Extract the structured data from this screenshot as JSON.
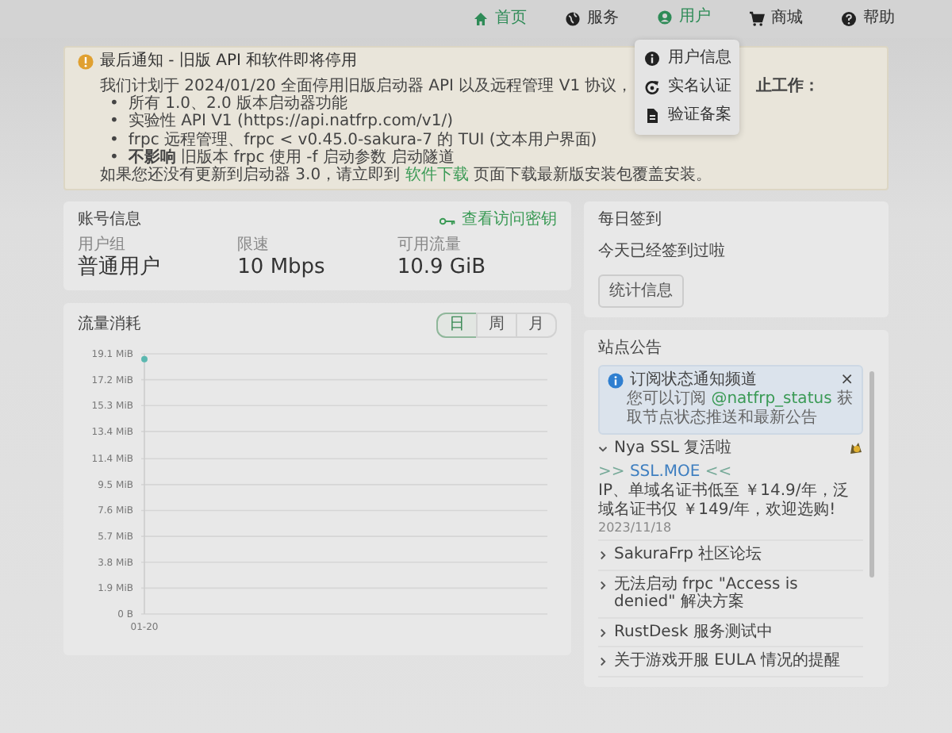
{
  "nav": {
    "items": [
      {
        "label": "首页",
        "highlighted": true
      },
      {
        "label": "服务",
        "highlighted": false
      },
      {
        "label": "用户",
        "highlighted": true,
        "dropdown": [
          {
            "label": "用户信息"
          },
          {
            "label": "实名认证"
          },
          {
            "label": "验证备案"
          }
        ]
      },
      {
        "label": "商城",
        "highlighted": false
      },
      {
        "label": "帮助",
        "highlighted": false
      }
    ]
  },
  "notice": {
    "title": "最后通知 - 旧版 API 和软件即将停用",
    "intro": "我们计划于 2024/01/20 全面停用旧版启动器 API 以及远程管理 V1 协议，",
    "intro_tail": "止工作：",
    "bullets": [
      {
        "marker": "•",
        "text": "所有 1.0、2.0 版本启动器功能"
      },
      {
        "marker": "•",
        "text": "实验性 API V1 (https://api.natfrp.com/v1/)"
      },
      {
        "marker": "•",
        "text": "frpc 远程管理、frpc < v0.45.0-sakura-7 的 TUI (文本用户界面)"
      },
      {
        "marker": "•",
        "text": "**不影响** 旧版本 frpc 使用 -f 启动参数 启动隧道"
      }
    ],
    "footer_before": "如果您还没有更新到启动器 3.0，请立即到",
    "footer_link": "软件下载",
    "footer_after": "页面下载最新版安装包覆盖安装。"
  },
  "account": {
    "title": "账号信息",
    "link": "查看访问密钥",
    "fields": [
      {
        "label": "用户组",
        "value": "普通用户"
      },
      {
        "label": "限速",
        "value": "10 Mbps"
      },
      {
        "label": "可用流量",
        "value": "10.9 GiB"
      }
    ]
  },
  "traffic": {
    "title": "流量消耗",
    "periods": [
      {
        "label": "日",
        "selected": true
      },
      {
        "label": "周",
        "selected": false
      },
      {
        "label": "月",
        "selected": false
      }
    ],
    "chart_data": {
      "type": "line",
      "grid": true,
      "categories": [
        "01-20"
      ],
      "series": [
        {
          "color": "#5bb8b0",
          "marker": true,
          "values": [
            18.7
          ]
        }
      ],
      "ylim": [
        0,
        19.1
      ],
      "yticks": [
        {
          "value": 0,
          "label": "0 B"
        },
        {
          "value": 1.9,
          "label": "1.9 MiB"
        },
        {
          "value": 3.8,
          "label": "3.8 MiB"
        },
        {
          "value": 5.7,
          "label": "5.7 MiB"
        },
        {
          "value": 7.6,
          "label": "7.6 MiB"
        },
        {
          "value": 9.5,
          "label": "9.5 MiB"
        },
        {
          "value": 11.4,
          "label": "11.4 MiB"
        },
        {
          "value": 13.4,
          "label": "13.4 MiB"
        },
        {
          "value": 15.3,
          "label": "15.3 MiB"
        },
        {
          "value": 17.2,
          "label": "17.2 MiB"
        },
        {
          "value": 19.1,
          "label": "19.1 MiB"
        }
      ]
    }
  },
  "signin": {
    "title": "每日签到",
    "text": "今天已经签到过啦",
    "button": "统计信息"
  },
  "announcements": {
    "title": "站点公告",
    "alert": {
      "title": "订阅状态通知频道",
      "before": "您可以订阅",
      "link": "@natfrp_status",
      "after": "获取节点状态推送和最新公告",
      "close": "×"
    },
    "items": [
      {
        "title": "Nya SSL 复活啦",
        "expanded": true,
        "link_before": ">>",
        "link": "SSL.MOE",
        "link_after": "<<",
        "body": "IP、单域名证书低至 ￥14.9/年，泛域名证书仅 ￥149/年，欢迎选购!",
        "date": "2023/11/18"
      },
      {
        "title": "SakuraFrp 社区论坛",
        "expanded": false
      },
      {
        "title": "无法启动 frpc \"Access is denied\" 解决方案",
        "expanded": false
      },
      {
        "title": "RustDesk 服务测试中",
        "expanded": false
      },
      {
        "title": "关于游戏开服 EULA 情况的提醒",
        "expanded": false
      }
    ]
  }
}
